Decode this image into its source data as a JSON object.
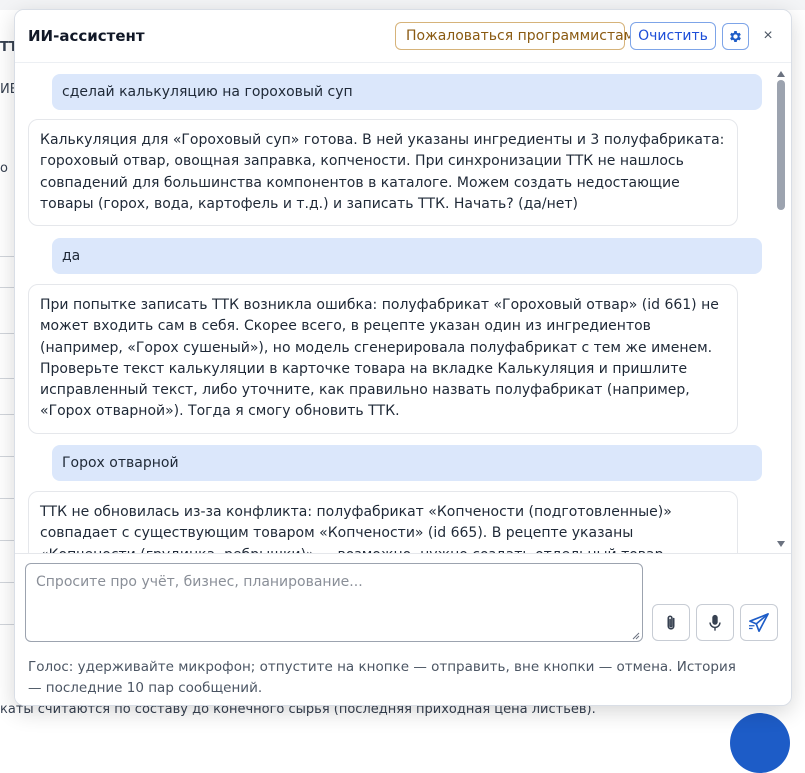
{
  "background": {
    "left_fragments": [
      "ТТ",
      "ИЕ",
      "о"
    ],
    "footer_text": "каты считаются по составу до конечного сырья (последняя приходная цена листьев)."
  },
  "assistant": {
    "title": "ИИ-ассистент",
    "buttons": {
      "complain": "Пожаловаться программистам",
      "clear": "Очистить",
      "close": "×"
    },
    "messages": [
      {
        "role": "user",
        "text": "сделай калькуляцию на гороховый суп"
      },
      {
        "role": "assistant",
        "text": "Калькуляция для «Гороховый суп» готова. В ней указаны ингредиенты и 3 полуфабриката: гороховый отвар, овощная заправка, копчености. При синхронизации ТТК не нашлось совпадений для большинства компонентов в каталоге. Можем создать недостающие товары (горох, вода, картофель и т.д.) и записать ТТК. Начать? (да/нет)"
      },
      {
        "role": "user",
        "text": "да"
      },
      {
        "role": "assistant",
        "text": "При попытке записать ТТК возникла ошибка: полуфабрикат «Гороховый отвар» (id 661) не может входить сам в себя. Скорее всего, в рецепте указан один из ингредиентов (например, «Горох сушеный»), но модель сгенерировала полуфабрикат с тем же именем. Проверьте текст калькуляции в карточке товара на вкладке Калькуляция и пришлите исправленный текст, либо уточните, как правильно назвать полуфабрикат (например, «Горох отварной»). Тогда я смогу обновить ТТК."
      },
      {
        "role": "user",
        "text": "Горох отварной"
      },
      {
        "role": "assistant",
        "text": "ТТК не обновилась из-за конфликта: полуфабрикат «Копчености (подготовленные)» совпадает с существующим товаром «Копчености» (id 665). В рецепте указаны «Копчености (грудинка, ребрышки)» — возможно, нужно создать отдельный товар «Копчености для супа» или"
      }
    ],
    "input": {
      "value": "",
      "placeholder": "Спросите про учёт, бизнес, планирование..."
    },
    "icons": {
      "settings": "gear-icon",
      "attach": "paperclip-icon",
      "voice": "microphone-icon",
      "send": "send-icon"
    },
    "hint": "Голос: удерживайте микрофон; отпустите на кнопке — отправить, вне кнопки — отмена. История — последние 10 пар сообщений.",
    "colors": {
      "user_bubble": "#dbe7fb",
      "complain_border": "#d6b37a",
      "accent": "#1d4ed8",
      "send_icon": "#1d5cc7"
    }
  }
}
